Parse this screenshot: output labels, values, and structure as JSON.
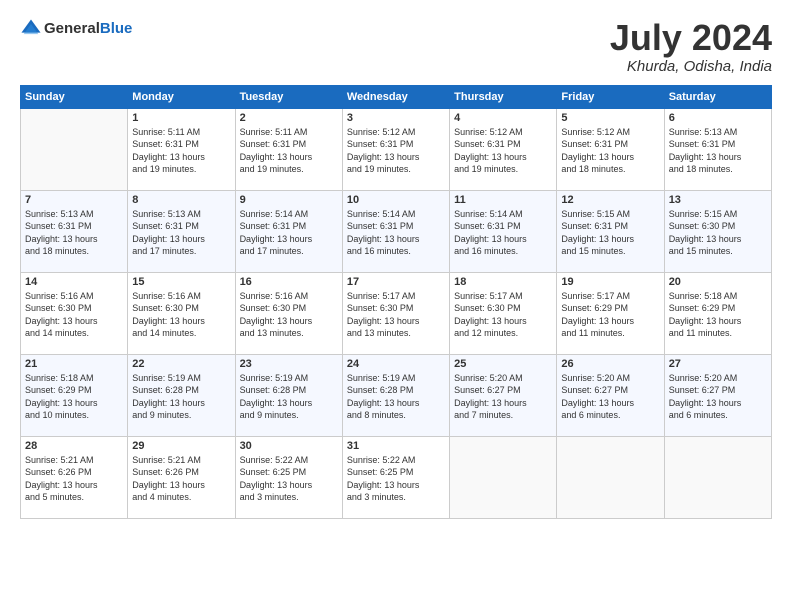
{
  "header": {
    "logo_general": "General",
    "logo_blue": "Blue",
    "title": "July 2024",
    "location": "Khurda, Odisha, India"
  },
  "days_of_week": [
    "Sunday",
    "Monday",
    "Tuesday",
    "Wednesday",
    "Thursday",
    "Friday",
    "Saturday"
  ],
  "weeks": [
    [
      {
        "day": "",
        "info": ""
      },
      {
        "day": "1",
        "info": "Sunrise: 5:11 AM\nSunset: 6:31 PM\nDaylight: 13 hours\nand 19 minutes."
      },
      {
        "day": "2",
        "info": "Sunrise: 5:11 AM\nSunset: 6:31 PM\nDaylight: 13 hours\nand 19 minutes."
      },
      {
        "day": "3",
        "info": "Sunrise: 5:12 AM\nSunset: 6:31 PM\nDaylight: 13 hours\nand 19 minutes."
      },
      {
        "day": "4",
        "info": "Sunrise: 5:12 AM\nSunset: 6:31 PM\nDaylight: 13 hours\nand 19 minutes."
      },
      {
        "day": "5",
        "info": "Sunrise: 5:12 AM\nSunset: 6:31 PM\nDaylight: 13 hours\nand 18 minutes."
      },
      {
        "day": "6",
        "info": "Sunrise: 5:13 AM\nSunset: 6:31 PM\nDaylight: 13 hours\nand 18 minutes."
      }
    ],
    [
      {
        "day": "7",
        "info": "Sunrise: 5:13 AM\nSunset: 6:31 PM\nDaylight: 13 hours\nand 18 minutes."
      },
      {
        "day": "8",
        "info": "Sunrise: 5:13 AM\nSunset: 6:31 PM\nDaylight: 13 hours\nand 17 minutes."
      },
      {
        "day": "9",
        "info": "Sunrise: 5:14 AM\nSunset: 6:31 PM\nDaylight: 13 hours\nand 17 minutes."
      },
      {
        "day": "10",
        "info": "Sunrise: 5:14 AM\nSunset: 6:31 PM\nDaylight: 13 hours\nand 16 minutes."
      },
      {
        "day": "11",
        "info": "Sunrise: 5:14 AM\nSunset: 6:31 PM\nDaylight: 13 hours\nand 16 minutes."
      },
      {
        "day": "12",
        "info": "Sunrise: 5:15 AM\nSunset: 6:31 PM\nDaylight: 13 hours\nand 15 minutes."
      },
      {
        "day": "13",
        "info": "Sunrise: 5:15 AM\nSunset: 6:30 PM\nDaylight: 13 hours\nand 15 minutes."
      }
    ],
    [
      {
        "day": "14",
        "info": "Sunrise: 5:16 AM\nSunset: 6:30 PM\nDaylight: 13 hours\nand 14 minutes."
      },
      {
        "day": "15",
        "info": "Sunrise: 5:16 AM\nSunset: 6:30 PM\nDaylight: 13 hours\nand 14 minutes."
      },
      {
        "day": "16",
        "info": "Sunrise: 5:16 AM\nSunset: 6:30 PM\nDaylight: 13 hours\nand 13 minutes."
      },
      {
        "day": "17",
        "info": "Sunrise: 5:17 AM\nSunset: 6:30 PM\nDaylight: 13 hours\nand 13 minutes."
      },
      {
        "day": "18",
        "info": "Sunrise: 5:17 AM\nSunset: 6:30 PM\nDaylight: 13 hours\nand 12 minutes."
      },
      {
        "day": "19",
        "info": "Sunrise: 5:17 AM\nSunset: 6:29 PM\nDaylight: 13 hours\nand 11 minutes."
      },
      {
        "day": "20",
        "info": "Sunrise: 5:18 AM\nSunset: 6:29 PM\nDaylight: 13 hours\nand 11 minutes."
      }
    ],
    [
      {
        "day": "21",
        "info": "Sunrise: 5:18 AM\nSunset: 6:29 PM\nDaylight: 13 hours\nand 10 minutes."
      },
      {
        "day": "22",
        "info": "Sunrise: 5:19 AM\nSunset: 6:28 PM\nDaylight: 13 hours\nand 9 minutes."
      },
      {
        "day": "23",
        "info": "Sunrise: 5:19 AM\nSunset: 6:28 PM\nDaylight: 13 hours\nand 9 minutes."
      },
      {
        "day": "24",
        "info": "Sunrise: 5:19 AM\nSunset: 6:28 PM\nDaylight: 13 hours\nand 8 minutes."
      },
      {
        "day": "25",
        "info": "Sunrise: 5:20 AM\nSunset: 6:27 PM\nDaylight: 13 hours\nand 7 minutes."
      },
      {
        "day": "26",
        "info": "Sunrise: 5:20 AM\nSunset: 6:27 PM\nDaylight: 13 hours\nand 6 minutes."
      },
      {
        "day": "27",
        "info": "Sunrise: 5:20 AM\nSunset: 6:27 PM\nDaylight: 13 hours\nand 6 minutes."
      }
    ],
    [
      {
        "day": "28",
        "info": "Sunrise: 5:21 AM\nSunset: 6:26 PM\nDaylight: 13 hours\nand 5 minutes."
      },
      {
        "day": "29",
        "info": "Sunrise: 5:21 AM\nSunset: 6:26 PM\nDaylight: 13 hours\nand 4 minutes."
      },
      {
        "day": "30",
        "info": "Sunrise: 5:22 AM\nSunset: 6:25 PM\nDaylight: 13 hours\nand 3 minutes."
      },
      {
        "day": "31",
        "info": "Sunrise: 5:22 AM\nSunset: 6:25 PM\nDaylight: 13 hours\nand 3 minutes."
      },
      {
        "day": "",
        "info": ""
      },
      {
        "day": "",
        "info": ""
      },
      {
        "day": "",
        "info": ""
      }
    ]
  ]
}
